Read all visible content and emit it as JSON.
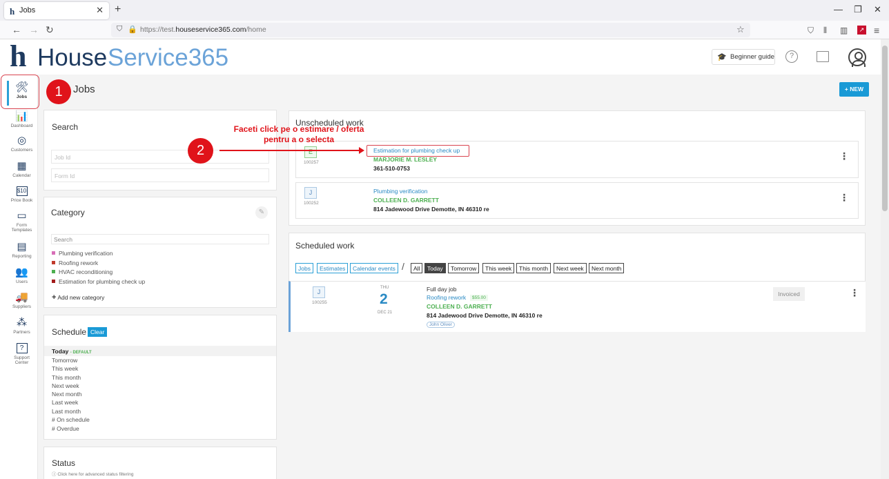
{
  "browser": {
    "tab_title": "Jobs",
    "tab_favicon": "h",
    "url_prefix": "https://test.",
    "url_domain": "houseservice365.com",
    "url_path": "/home"
  },
  "header": {
    "logo_h": "h",
    "logo_part1": "House",
    "logo_part2": "Service365",
    "beginner_guide": "Beginner guide",
    "help_icon": "?"
  },
  "sidebar": {
    "items": [
      {
        "label": "Jobs",
        "icon": "🛠"
      },
      {
        "label": "Dashboard",
        "icon": "📊"
      },
      {
        "label": "Customers",
        "icon": "◎"
      },
      {
        "label": "Calendar",
        "icon": "▦"
      },
      {
        "label": "Price Book",
        "icon": "$10"
      },
      {
        "label": "Form",
        "label2": "Templates",
        "icon": "▭"
      },
      {
        "label": "Reporting",
        "icon": "▤"
      },
      {
        "label": "Users",
        "icon": "👥"
      },
      {
        "label": "Suppliers",
        "icon": "🚚"
      },
      {
        "label": "Partners",
        "icon": "⁂"
      },
      {
        "label": "Support",
        "label2": "Center",
        "icon": "?"
      }
    ]
  },
  "page": {
    "title": "Jobs",
    "new_button": "+ NEW"
  },
  "annotations": {
    "step1": "1",
    "step2": "2",
    "step2_text_line1": "Faceti click pe o estimare / oferta",
    "step2_text_line2": "pentru a o selecta"
  },
  "search_panel": {
    "title": "Search",
    "job_id_placeholder": "Job Id",
    "form_id_placeholder": "Form Id"
  },
  "category_panel": {
    "title": "Category",
    "search_placeholder": "Search",
    "items": [
      {
        "label": "Plumbing verification",
        "color": "#d86fb8"
      },
      {
        "label": "Roofing rework",
        "color": "#c0392b"
      },
      {
        "label": "HVAC reconditioning",
        "color": "#4caf50"
      },
      {
        "label": "Estimation for plumbing check up",
        "color": "#a31c1c"
      }
    ],
    "add_new": "Add new category"
  },
  "schedule_panel": {
    "title": "Schedule",
    "clear": "Clear",
    "today": "Today",
    "default_tag": "- DEFAULT",
    "items": [
      "Tomorrow",
      "This week",
      "This month",
      "Next week",
      "Next month",
      "Last week",
      "Last month",
      "# On schedule",
      "# Overdue"
    ]
  },
  "status_panel": {
    "title": "Status",
    "hint": "Click here for advanced status filtering"
  },
  "unscheduled": {
    "title": "Unscheduled work",
    "jobs": [
      {
        "badge": "E",
        "id": "100257",
        "title": "Estimation for plumbing check up",
        "customer": "MARJORIE M. LESLEY",
        "detail": "361-510-0753"
      },
      {
        "badge": "J",
        "id": "100252",
        "title": "Plumbing verification",
        "customer": "COLLEEN D. GARRETT",
        "detail": "814 Jadewood Drive Demotte, IN 46310 re"
      }
    ]
  },
  "scheduled": {
    "title": "Scheduled work",
    "type_filters": [
      "Jobs",
      "Estimates",
      "Calendar events"
    ],
    "separator": "/",
    "time_filters": [
      "All",
      "Today",
      "Tomorrow",
      "This week",
      "This month",
      "Next week",
      "Next month"
    ],
    "active_filter": "Today",
    "job": {
      "badge": "J",
      "id": "100255",
      "dow": "THU",
      "day": "2",
      "month": "DEC 21",
      "timing": "Full day job",
      "title": "Roofing rework",
      "price": "$55.00",
      "customer": "COLLEEN D. GARRETT",
      "address": "814 Jadewood Drive Demotte, IN 46310 re",
      "tech": "John Oliver",
      "status": "Invoiced"
    }
  }
}
